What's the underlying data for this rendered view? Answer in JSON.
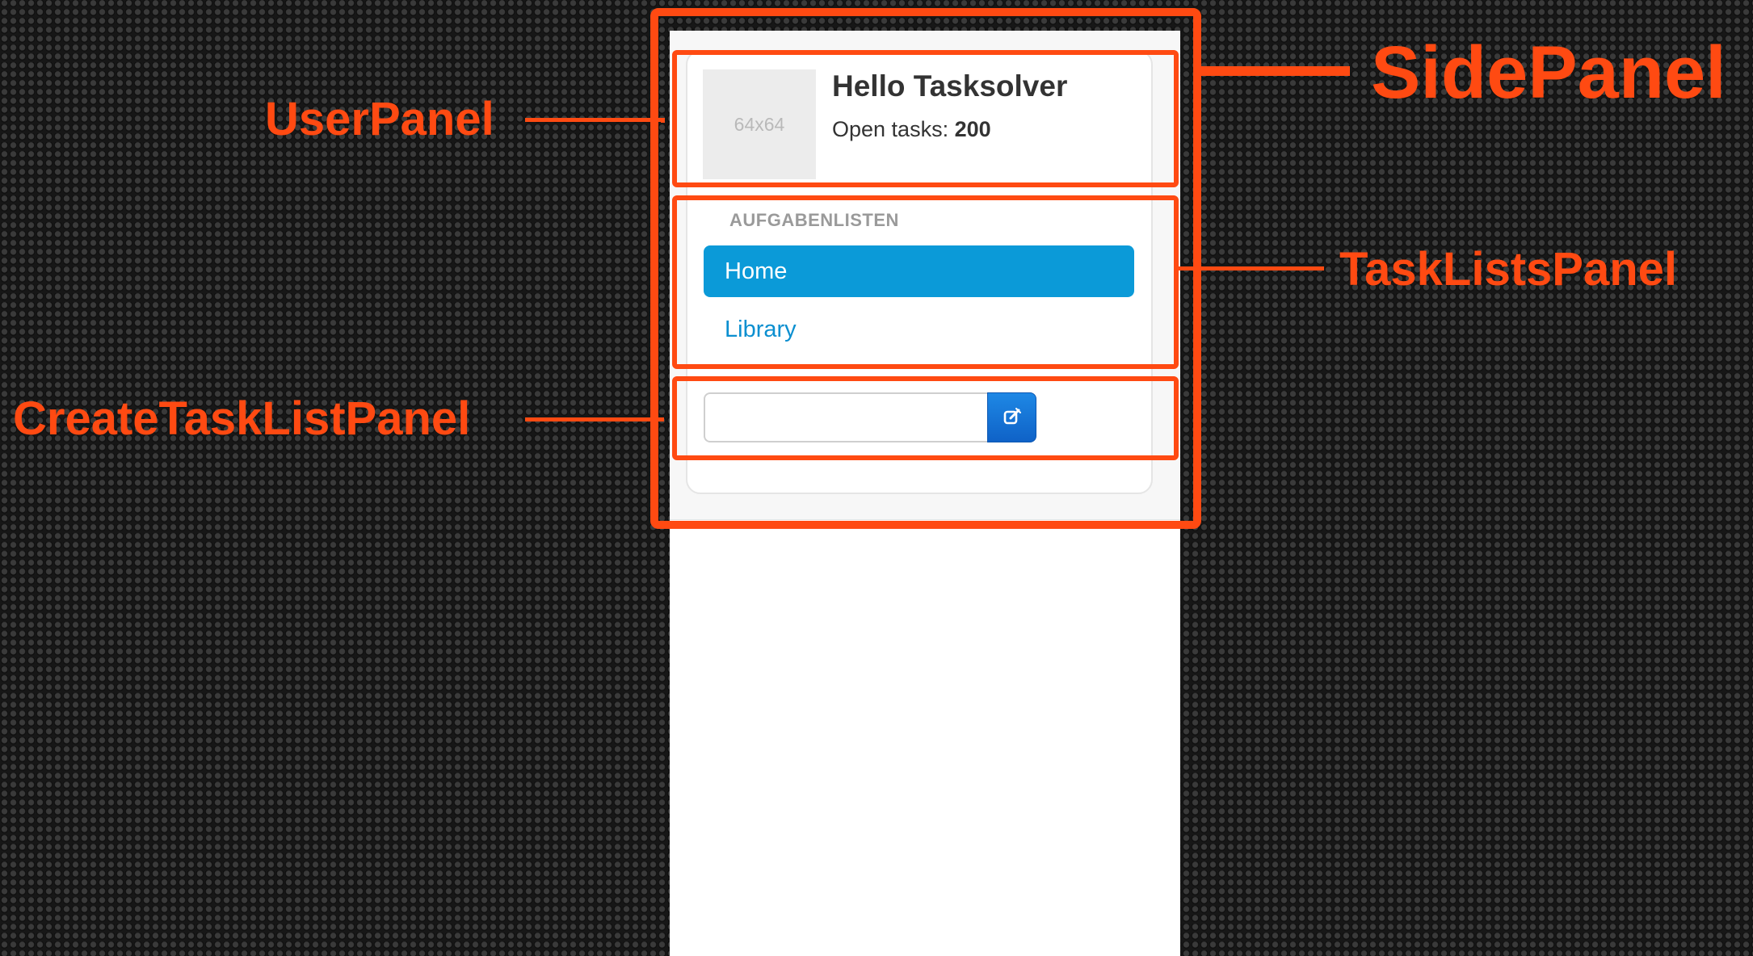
{
  "user_panel": {
    "avatar_placeholder": "64x64",
    "greeting": "Hello Tasksolver",
    "open_tasks_label": "Open tasks:",
    "open_tasks_count": "200"
  },
  "task_lists_panel": {
    "heading": "AUFGABENLISTEN",
    "items": [
      {
        "label": "Home",
        "active": true
      },
      {
        "label": "Library",
        "active": false
      }
    ]
  },
  "create_task_list_panel": {
    "input_value": "",
    "button_icon": "edit-icon"
  },
  "annotations": {
    "side_panel": "SidePanel",
    "user_panel": "UserPanel",
    "task_lists_panel": "TaskListsPanel",
    "create_task_list_panel": "CreateTaskListPanel"
  },
  "colors": {
    "annotation": "#ff4a12",
    "active_nav": "#0b9ad8",
    "link": "#0b8fd0",
    "button": "#1675d8"
  }
}
